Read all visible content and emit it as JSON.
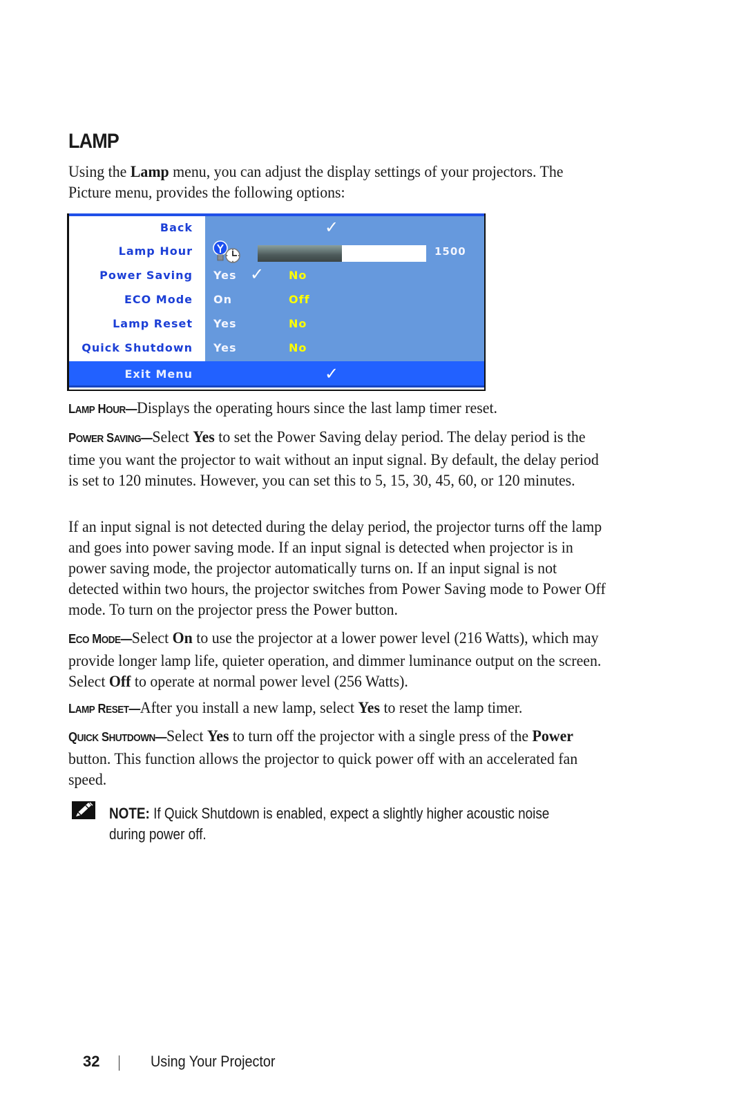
{
  "section": {
    "title": "LAMP",
    "intro_parts": [
      "Using the ",
      "Lamp",
      " menu, you can adjust the display settings of your projectors. The Picture menu, provides the following options:"
    ]
  },
  "osd_menu": {
    "colors": {
      "panel": "#6699dd",
      "label": "#1c3fd6",
      "selected_bar": "#2261ff",
      "inactive_option": "#ffff00",
      "active_option": "#ffffff"
    },
    "rows": [
      {
        "label": "Back",
        "check": true
      },
      {
        "label": "Lamp Hour",
        "icon": "lamp-clock-icon",
        "bar_fill_fraction": 0.5,
        "value": "1500"
      },
      {
        "label": "Power Saving",
        "options": [
          "Yes",
          "No"
        ],
        "selected": "Yes"
      },
      {
        "label": "ECO Mode",
        "options": [
          "On",
          "Off"
        ]
      },
      {
        "label": "Lamp Reset",
        "options": [
          "Yes",
          "No"
        ]
      },
      {
        "label": "Quick Shutdown",
        "options": [
          "Yes",
          "No"
        ]
      }
    ],
    "exit": {
      "label": "Exit Menu",
      "check": true
    }
  },
  "descriptions": {
    "lamp_hour": {
      "lead_first": "L",
      "lead_rest": "AMP",
      "lead_first2": "H",
      "lead_rest2": "OUR",
      "text": "Displays the operating hours since the last lamp timer reset."
    },
    "power_saving": {
      "lead_first": "P",
      "lead_rest": "OWER",
      "lead_first2": "S",
      "lead_rest2": "AVING",
      "t1": "Select ",
      "k1": "Yes",
      "t2": " to set the Power Saving delay period. The delay period is the time you want the projector to wait without an input signal. By default, the delay period is set to 120 minutes. However, you can set this to 5, 15, 30, 45, 60, or 120 minutes."
    },
    "signal_paragraph": "If an input signal is not detected during the delay period, the projector turns off the lamp and goes into power saving mode. If an input signal is detected when projector is in power saving mode, the projector automatically turns on. If an input signal is not detected within two hours, the projector switches from Power Saving mode to Power Off mode. To turn on the projector press the Power button.",
    "eco_mode": {
      "lead_first": "E",
      "lead_rest": "CO",
      "lead_first2": "M",
      "lead_rest2": "ODE",
      "t1": "Select ",
      "k1": "On",
      "t2": " to use the projector at a lower power level (216 Watts), which may provide longer lamp life, quieter operation, and dimmer luminance output on the screen. Select ",
      "k2": "Off",
      "t3": " to operate at normal power level (256 Watts)."
    },
    "lamp_reset": {
      "lead_first": "L",
      "lead_rest": "AMP",
      "lead_first2": "R",
      "lead_rest2": "ESET",
      "t1": "After you install a new lamp, select ",
      "k1": "Yes",
      "t2": " to reset the lamp timer."
    },
    "quick_shutdown": {
      "lead_first": "Q",
      "lead_rest": "UICK",
      "lead_first2": "S",
      "lead_rest2": "HUTDOWN",
      "t1": "Select ",
      "k1": "Yes",
      "t2": " to turn off the projector with a single press of the ",
      "k2": "Power",
      "t3": " button. This function allows the projector to quick power off with an accelerated fan speed."
    },
    "dash": "—"
  },
  "note": {
    "label": "NOTE:",
    "text": " If Quick Shutdown is enabled, expect a slightly higher acoustic noise during power off."
  },
  "footer": {
    "page_number": "32",
    "chapter": "Using Your Projector"
  }
}
